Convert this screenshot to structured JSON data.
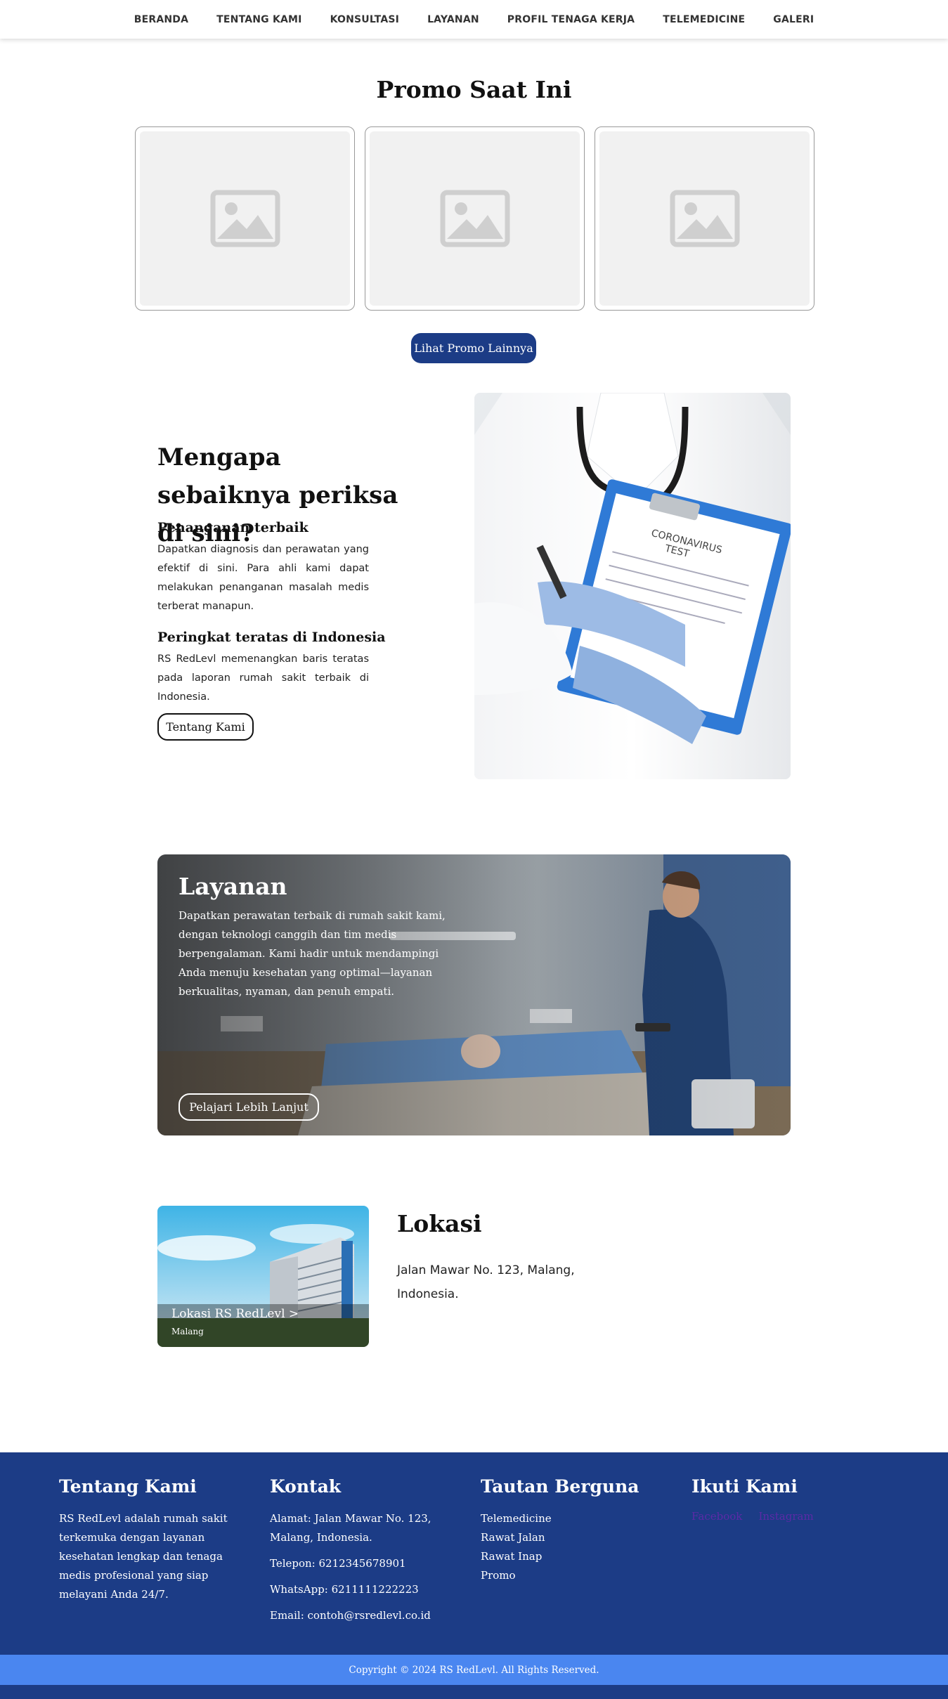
{
  "nav": {
    "items": [
      "BERANDA",
      "TENTANG KAMI",
      "KONSULTASI",
      "LAYANAN",
      "PROFIL TENAGA KERJA",
      "TELEMEDICINE",
      "GALERI"
    ]
  },
  "promo": {
    "title": "Promo Saat Ini",
    "cards": [
      {
        "icon": "image-placeholder-icon"
      },
      {
        "icon": "image-placeholder-icon"
      },
      {
        "icon": "image-placeholder-icon"
      }
    ],
    "button_label": "Lihat Promo Lainnya"
  },
  "why": {
    "title": "Mengapa sebaiknya periksa di sini?",
    "point1_title": "Penanganan terbaik",
    "point1_text": "Dapatkan diagnosis dan perawatan yang efektif di sini. Para ahli kami dapat melakukan penanganan masalah medis terberat manapun.",
    "point2_title": "Peringkat teratas di Indonesia",
    "point2_text": "RS RedLevl memenangkan baris teratas pada laporan rumah sakit terbaik di Indonesia.",
    "button_label": "Tentang Kami",
    "clipboard_line1": "CORONAVIRUS",
    "clipboard_line2": "TEST"
  },
  "layanan": {
    "title": "Layanan",
    "text": "Dapatkan perawatan terbaik di rumah sakit kami, dengan teknologi canggih dan tim medis berpengalaman. Kami hadir untuk mendampingi Anda menuju kesehatan yang optimal—layanan berkualitas, nyaman, dan penuh empati.",
    "button_label": "Pelajari Lebih Lanjut"
  },
  "lokasi": {
    "card_title": "Lokasi RS RedLevl >",
    "card_subtitle": "Malang",
    "title": "Lokasi",
    "address": "Jalan Mawar No. 123, Malang, Indonesia."
  },
  "footer": {
    "about": {
      "title": "Tentang Kami",
      "text": "RS RedLevl adalah rumah sakit terkemuka dengan layanan kesehatan lengkap dan tenaga medis profesional yang siap melayani Anda 24/7."
    },
    "contact": {
      "title": "Kontak",
      "address": "Alamat: Jalan Mawar No. 123, Malang, Indonesia.",
      "phone": "Telepon: 6212345678901",
      "whatsapp": "WhatsApp: 6211111222223",
      "email": "Email: contoh@rsredlevl.co.id"
    },
    "links": {
      "title": "Tautan Berguna",
      "items": [
        "Telemedicine",
        "Rawat Jalan",
        "Rawat Inap",
        "Promo"
      ]
    },
    "social": {
      "title": "Ikuti Kami",
      "items": [
        "Facebook",
        "Instagram"
      ]
    },
    "copyright": "Copyright © 2024 RS RedLevl. All Rights Reserved."
  },
  "colors": {
    "primary": "#1c3c86",
    "accent": "#4a86f0",
    "social_link": "#5b2aa6"
  }
}
